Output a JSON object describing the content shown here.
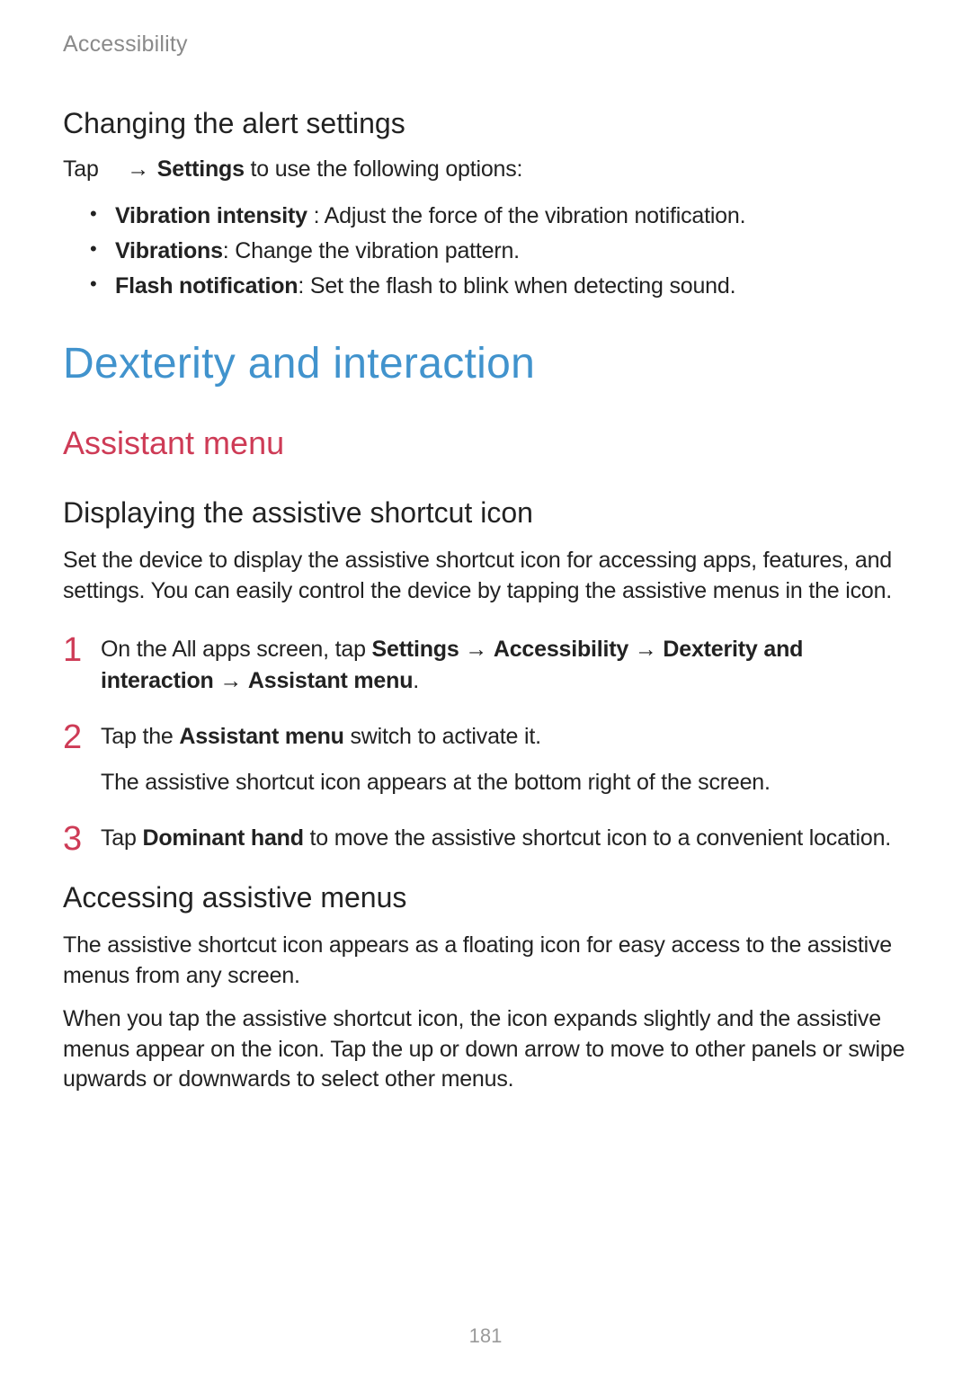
{
  "breadcrumb": "Accessibility",
  "section_alert": {
    "heading": "Changing the alert settings",
    "tap_prefix": "Tap",
    "tap_arrow": "→",
    "tap_bold": "Settings",
    "tap_suffix": " to use the following options:",
    "bullets": [
      {
        "bold": "Vibration intensity",
        "rest": " : Adjust the force of the vibration notification."
      },
      {
        "bold": "Vibrations",
        "rest": ": Change the vibration pattern."
      },
      {
        "bold": "Flash notification",
        "rest": ": Set the flash to blink when detecting sound."
      }
    ]
  },
  "h1": "Dexterity and interaction",
  "h2": "Assistant menu",
  "section_display": {
    "heading": "Displaying the assistive shortcut icon",
    "intro": "Set the device to display the assistive shortcut icon for accessing apps, features, and settings. You can easily control the device by tapping the assistive menus in the icon.",
    "steps": {
      "s1": {
        "pre": "On the All apps screen, tap ",
        "b1": "Settings",
        "a1": " → ",
        "b2": "Accessibility",
        "a2": " → ",
        "b3": "Dexterity and interaction",
        "a3": " → ",
        "b4": "Assistant menu",
        "post": "."
      },
      "s2": {
        "pre": "Tap the ",
        "b1": "Assistant menu",
        "post": " switch to activate it.",
        "sub": "The assistive shortcut icon appears at the bottom right of the screen."
      },
      "s3": {
        "pre": "Tap ",
        "b1": "Dominant hand",
        "post": " to move the assistive shortcut icon to a convenient location."
      }
    }
  },
  "section_access": {
    "heading": "Accessing assistive menus",
    "p1": "The assistive shortcut icon appears as a floating icon for easy access to the assistive menus from any screen.",
    "p2": "When you tap the assistive shortcut icon, the icon expands slightly and the assistive menus appear on the icon. Tap the up or down arrow to move to other panels or swipe upwards or downwards to select other menus."
  },
  "page_number": "181"
}
